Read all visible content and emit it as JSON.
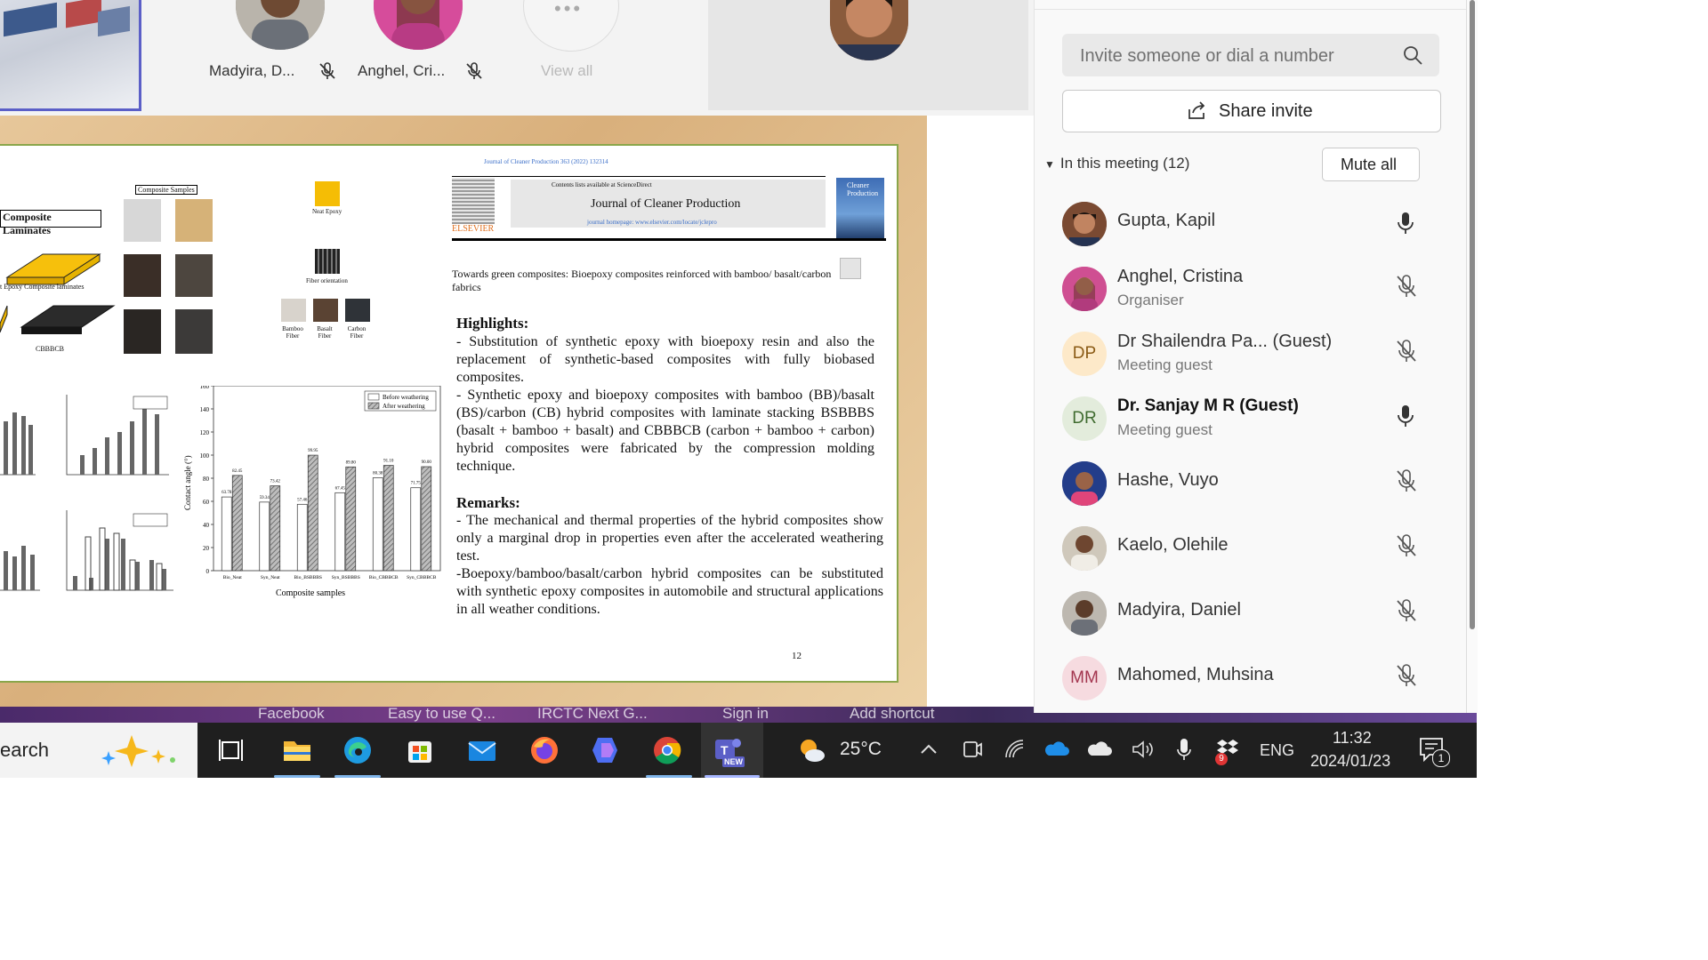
{
  "top_strip": {
    "tiles": [
      {
        "name": "Madyira, D..."
      },
      {
        "name": "Anghel, Cri..."
      }
    ],
    "view_all_label": "View all"
  },
  "slide": {
    "journal_header_line": "Journal of Cleaner Production 363 (2022) 132314",
    "contents_available": "Contents lists available at ScienceDirect",
    "journal_title": "Journal of Cleaner Production",
    "journal_homepage": "journal homepage: www.elsevier.com/locate/jclepro",
    "publisher": "ELSEVIER",
    "cover_text": "Cleaner Production",
    "article_title": "Towards green composites: Bioepoxy composites reinforced with bamboo/ basalt/carbon fabrics",
    "composite_laminates_label": "Composite Laminates",
    "neat_epoxy_laminates_label": "t Epoxy Composite laminates",
    "cbbbcb_label": "CBBBCB",
    "composite_samples_label": "Composite Samples",
    "neat_epoxy_label": "Neat Epoxy",
    "fiber_orientation_label": "Fiber orientation",
    "fiber_labels": [
      "Bamboo Fiber",
      "Basalt Fiber",
      "Carbon Fiber"
    ],
    "highlights_heading": "Highlights:",
    "highlights": [
      "- Substitution of synthetic epoxy with bioepoxy resin and also the replacement of synthetic-based composites with fully biobased composites.",
      "- Synthetic epoxy and bioepoxy composites with bamboo (BB)/basalt (BS)/carbon (CB) hybrid composites with laminate stacking BSBBBS (basalt + bamboo + basalt) and CBBBCB (carbon + bamboo + carbon) hybrid composites were fabricated by the compression molding technique."
    ],
    "remarks_heading": "Remarks:",
    "remarks": [
      "- The mechanical and thermal properties of the hybrid composites show only a marginal drop in properties even after the accelerated weathering test.",
      "-Boepoxy/bamboo/basalt/carbon hybrid composites can be substituted with synthetic epoxy composites in automobile and structural applications in all weather conditions."
    ],
    "page_number": "12"
  },
  "chart_data": {
    "type": "bar",
    "categories": [
      "Bio_Neat",
      "Syn_Neat",
      "Bio_BSBBBS",
      "Syn_BSBBBS",
      "Bio_CBBBCB",
      "Syn_CBBBCB"
    ],
    "series": [
      {
        "name": "Before weathering",
        "values": [
          63.78,
          59.34,
          57.46,
          67.45,
          80.38,
          71.75
        ]
      },
      {
        "name": "After weathering",
        "values": [
          82.45,
          73.42,
          99.95,
          89.8,
          91.1,
          90.0
        ]
      }
    ],
    "value_labels": [
      [
        "63.78",
        "59.34",
        "57.46",
        "67.45",
        "80.38",
        "71.75"
      ],
      [
        "82.45",
        "73.42",
        "99.95",
        "89.80",
        "91.10",
        "90.00"
      ]
    ],
    "xlabel": "Composite samples",
    "ylabel": "Contact angle (°)",
    "ylim": [
      0,
      160
    ],
    "yticks": [
      "0",
      "20",
      "40",
      "60",
      "80",
      "100",
      "120",
      "140",
      "160"
    ],
    "legend": [
      "Before weathering",
      "After weathering"
    ],
    "legend_position": "top-right",
    "colors": {
      "before": "#ffffff",
      "after": "#9a9a9a"
    }
  },
  "browser_bar": [
    "Facebook",
    "Easy to use Q...",
    "IRCTC Next G...",
    "Sign in",
    "Add shortcut"
  ],
  "taskbar": {
    "search_text": "earch",
    "weather_temp": "25°C",
    "language": "ENG",
    "time": "11:32",
    "date": "2024/01/23",
    "notification_count": "1",
    "mail_badge": "9",
    "teams_badge": "NEW",
    "apps": [
      "task-view",
      "file-explorer",
      "edge",
      "microsoft-store",
      "mail",
      "firefox",
      "copilot",
      "chrome",
      "teams"
    ]
  },
  "panel": {
    "invite_placeholder": "Invite someone or dial a number",
    "share_invite_label": "Share invite",
    "in_meeting_label": "In this meeting (12)",
    "mute_all_label": "Mute all",
    "participants": [
      {
        "name": "Gupta, Kapil",
        "role": "",
        "initials": "",
        "mic": "on"
      },
      {
        "name": "Anghel, Cristina",
        "role": "Organiser",
        "initials": "",
        "mic": "muted"
      },
      {
        "name": "Dr Shailendra Pa... (Guest)",
        "role": "Meeting guest",
        "initials": "DP",
        "mic": "muted"
      },
      {
        "name": "Dr. Sanjay M R (Guest)",
        "role": "Meeting guest",
        "initials": "DR",
        "mic": "on"
      },
      {
        "name": "Hashe, Vuyo",
        "role": "",
        "initials": "",
        "mic": "muted"
      },
      {
        "name": "Kaelo, Olehile",
        "role": "",
        "initials": "",
        "mic": "muted"
      },
      {
        "name": "Madyira, Daniel",
        "role": "",
        "initials": "",
        "mic": "muted"
      },
      {
        "name": "Mahomed, Muhsina",
        "role": "",
        "initials": "MM",
        "mic": "muted"
      }
    ],
    "accent_color": "#5b5fc7"
  }
}
